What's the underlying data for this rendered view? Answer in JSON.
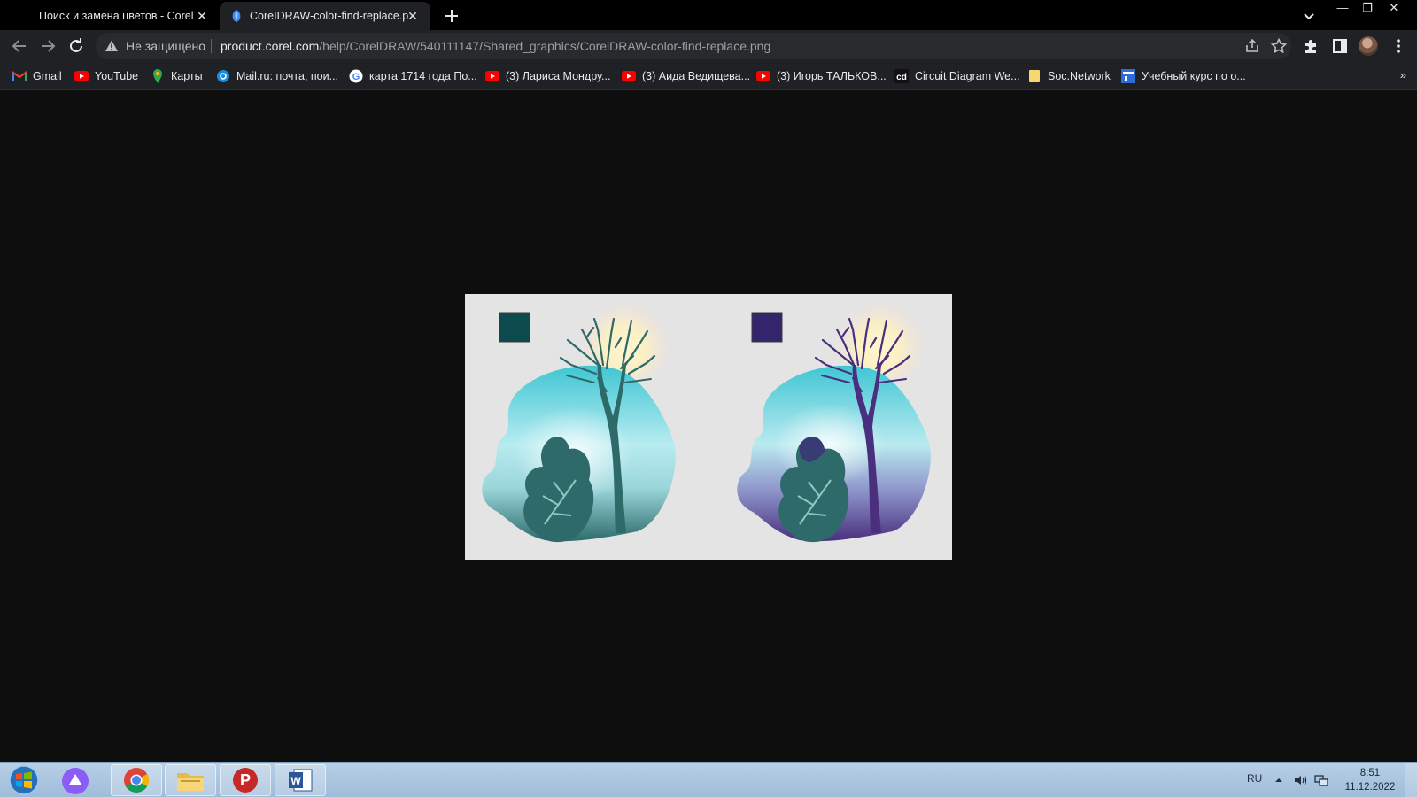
{
  "browser": {
    "tabs": [
      {
        "title": "Поиск и замена цветов - CorelDRAW",
        "active": false
      },
      {
        "title": "CoreIDRAW-color-find-replace.png",
        "active": true
      }
    ],
    "new_tab_icon": "plus-icon",
    "omnibox": {
      "security_label": "Не защищено",
      "url_host": "product.corel.com",
      "url_path": "/help/CorelDRAW/540111147/Shared_graphics/CorelDRAW-color-find-replace.png"
    },
    "bookmarks": [
      {
        "label": "Gmail",
        "icon": "gmail-icon"
      },
      {
        "label": "YouTube",
        "icon": "youtube-icon"
      },
      {
        "label": "Карты",
        "icon": "maps-icon"
      },
      {
        "label": "Mail.ru: почта, пои...",
        "icon": "mailru-icon"
      },
      {
        "label": "карта 1714 года По...",
        "icon": "google-icon"
      },
      {
        "label": "(3) Лариса Мондру...",
        "icon": "youtube-icon"
      },
      {
        "label": "(3) Аида Ведищева...",
        "icon": "youtube-icon"
      },
      {
        "label": "(3) Игорь ТАЛЬКОВ...",
        "icon": "youtube-icon"
      },
      {
        "label": "Circuit Diagram We...",
        "icon": "circuit-icon"
      },
      {
        "label": "Soc.Network",
        "icon": "folder-icon"
      },
      {
        "label": "Учебный курс по о...",
        "icon": "course-icon"
      }
    ],
    "bookmarks_overflow": "»"
  },
  "image": {
    "panels": [
      {
        "swatch_color": "#0d4a4d",
        "accent_color": "#2f6a6b",
        "variant": "original"
      },
      {
        "swatch_color": "#33256b",
        "accent_color": "#4a2f7e",
        "variant": "replaced"
      }
    ]
  },
  "taskbar": {
    "language": "RU",
    "time": "8:51",
    "date": "11.12.2022",
    "apps": [
      "chrome-icon",
      "file-explorer-icon",
      "p-app-icon",
      "word-icon"
    ]
  },
  "colors": {
    "tab_bg": "#000000",
    "toolbar_bg": "#202124",
    "content_bg": "#0e0e0e",
    "taskbar_bg": "#a8c4de"
  }
}
